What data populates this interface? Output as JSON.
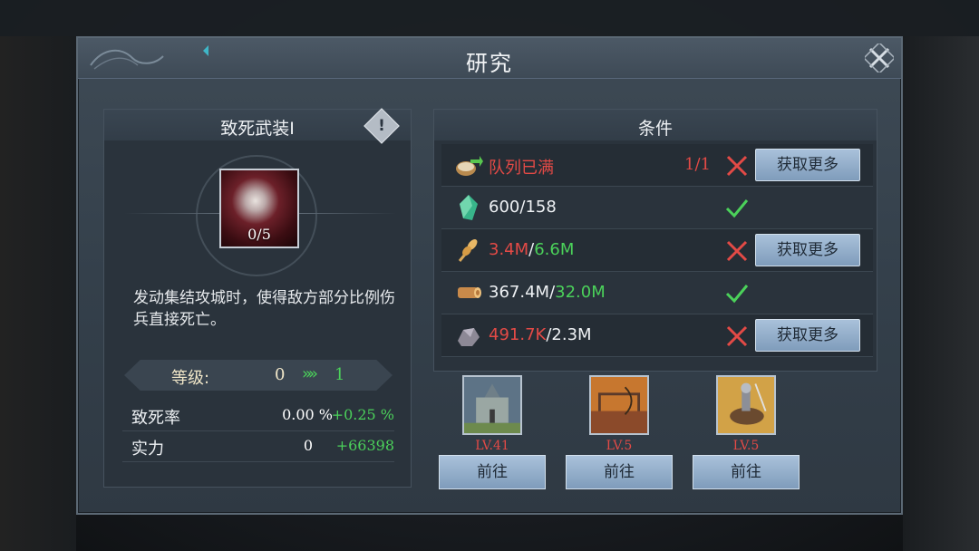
{
  "dialog": {
    "title": "研究",
    "close_icon": "close-icon"
  },
  "skill": {
    "name": "致死武装I",
    "info_badge": "!",
    "progress": "0/5",
    "description": "发动集结攻城时，使得敌方部分比例伤兵直接死亡。",
    "level_label": "等级:",
    "level_current": "0",
    "level_next": "1",
    "stats": [
      {
        "name": "致死率",
        "value": "0.00 %",
        "add": "+0.25 %"
      },
      {
        "name": "实力",
        "value": "0",
        "add": "+66398"
      }
    ]
  },
  "conditions": {
    "title": "条件",
    "get_more_label": "获取更多",
    "rows": [
      {
        "icon": "queue-icon",
        "text": "队列已满",
        "count": "1/1",
        "met": false
      },
      {
        "icon": "crystal-icon",
        "current": "600",
        "required": "158",
        "met": true
      },
      {
        "icon": "wheat-icon",
        "current": "3.4M",
        "required": "6.6M",
        "met": false
      },
      {
        "icon": "wood-icon",
        "current": "367.4M",
        "required": "32.0M",
        "met": true
      },
      {
        "icon": "ore-icon",
        "current": "491.7K",
        "required": "2.3M",
        "met": false
      }
    ]
  },
  "buildings": [
    {
      "icon": "castle-building-icon",
      "level": "LV.41",
      "go_label": "前往"
    },
    {
      "icon": "archery-building-icon",
      "level": "LV.5",
      "go_label": "前往"
    },
    {
      "icon": "cavalry-building-icon",
      "level": "LV.5",
      "go_label": "前往"
    }
  ],
  "colors": {
    "insufficient": "#e34a46",
    "sufficient": "#4bd15a",
    "button": "#9bb5d0"
  }
}
